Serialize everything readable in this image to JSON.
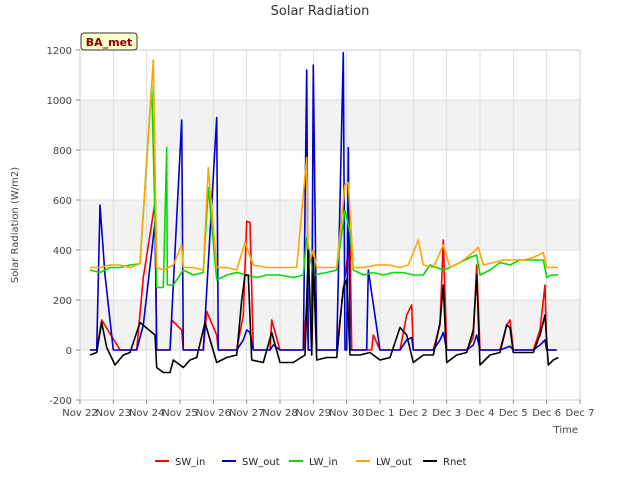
{
  "chart_data": {
    "type": "line",
    "title": "Solar Radiation",
    "xlabel": "Time",
    "ylabel": "Solar Radiation (W/m2)",
    "badge": "BA_met",
    "xlim": [
      0,
      15
    ],
    "ylim": [
      -200,
      1200
    ],
    "x_ticks": [
      {
        "pos": 0,
        "label": "Nov 22"
      },
      {
        "pos": 1,
        "label": "Nov 23"
      },
      {
        "pos": 2,
        "label": "Nov 24"
      },
      {
        "pos": 3,
        "label": "Nov 25"
      },
      {
        "pos": 4,
        "label": "Nov 26"
      },
      {
        "pos": 5,
        "label": "Nov 27"
      },
      {
        "pos": 6,
        "label": "Nov 28"
      },
      {
        "pos": 7,
        "label": "Nov 29"
      },
      {
        "pos": 8,
        "label": "Nov 30"
      },
      {
        "pos": 9,
        "label": "Dec 1"
      },
      {
        "pos": 10,
        "label": "Dec 2"
      },
      {
        "pos": 11,
        "label": "Dec 3"
      },
      {
        "pos": 12,
        "label": "Dec 4"
      },
      {
        "pos": 13,
        "label": "Dec 5"
      },
      {
        "pos": 14,
        "label": "Dec 6"
      },
      {
        "pos": 15,
        "label": "Dec 7"
      }
    ],
    "y_ticks": [
      -200,
      0,
      200,
      400,
      600,
      800,
      1000,
      1200
    ],
    "grid": true,
    "legend_position": "bottom",
    "series": [
      {
        "name": "SW_in",
        "color": "#ff0000",
        "points": [
          [
            0.3,
            0
          ],
          [
            0.5,
            0
          ],
          [
            0.65,
            120
          ],
          [
            1.2,
            0
          ],
          [
            1.7,
            0
          ],
          [
            1.9,
            290
          ],
          [
            2.25,
            590
          ],
          [
            2.3,
            0
          ],
          [
            2.7,
            0
          ],
          [
            2.75,
            120
          ],
          [
            3.05,
            80
          ],
          [
            3.1,
            0
          ],
          [
            3.7,
            0
          ],
          [
            3.8,
            155
          ],
          [
            4.1,
            60
          ],
          [
            4.15,
            0
          ],
          [
            4.7,
            0
          ],
          [
            4.9,
            140
          ],
          [
            5.0,
            515
          ],
          [
            5.1,
            510
          ],
          [
            5.2,
            0
          ],
          [
            5.7,
            0
          ],
          [
            5.75,
            120
          ],
          [
            6.0,
            0
          ],
          [
            6.7,
            0
          ],
          [
            6.8,
            180
          ],
          [
            6.85,
            0
          ],
          [
            6.95,
            0
          ],
          [
            7.0,
            360
          ],
          [
            7.1,
            0
          ],
          [
            7.7,
            0
          ],
          [
            7.9,
            240
          ],
          [
            8.1,
            450
          ],
          [
            8.15,
            0
          ],
          [
            8.75,
            0
          ],
          [
            8.8,
            60
          ],
          [
            9.0,
            0
          ],
          [
            9.6,
            0
          ],
          [
            9.8,
            140
          ],
          [
            9.95,
            180
          ],
          [
            10.0,
            0
          ],
          [
            10.6,
            0
          ],
          [
            10.8,
            100
          ],
          [
            10.9,
            440
          ],
          [
            11.0,
            0
          ],
          [
            11.6,
            0
          ],
          [
            11.8,
            50
          ],
          [
            11.9,
            340
          ],
          [
            12.0,
            0
          ],
          [
            12.6,
            0
          ],
          [
            12.8,
            100
          ],
          [
            12.9,
            120
          ],
          [
            13.0,
            0
          ],
          [
            13.6,
            0
          ],
          [
            13.8,
            80
          ],
          [
            13.95,
            260
          ],
          [
            14.0,
            0
          ],
          [
            14.3,
            0
          ]
        ]
      },
      {
        "name": "SW_out",
        "color": "#0000cc",
        "points": [
          [
            0.3,
            0
          ],
          [
            0.5,
            0
          ],
          [
            0.6,
            580
          ],
          [
            0.75,
            300
          ],
          [
            1.0,
            0
          ],
          [
            1.7,
            0
          ],
          [
            1.9,
            100
          ],
          [
            2.25,
            510
          ],
          [
            2.3,
            0
          ],
          [
            2.7,
            0
          ],
          [
            3.05,
            920
          ],
          [
            3.1,
            0
          ],
          [
            3.7,
            0
          ],
          [
            4.1,
            930
          ],
          [
            4.15,
            0
          ],
          [
            4.7,
            0
          ],
          [
            4.9,
            40
          ],
          [
            5.0,
            80
          ],
          [
            5.1,
            70
          ],
          [
            5.2,
            0
          ],
          [
            5.7,
            0
          ],
          [
            5.8,
            20
          ],
          [
            6.0,
            0
          ],
          [
            6.7,
            0
          ],
          [
            6.8,
            1120
          ],
          [
            6.85,
            0
          ],
          [
            6.95,
            0
          ],
          [
            7.0,
            1140
          ],
          [
            7.1,
            0
          ],
          [
            7.7,
            0
          ],
          [
            7.9,
            1190
          ],
          [
            7.95,
            0
          ],
          [
            8.0,
            0
          ],
          [
            8.05,
            810
          ],
          [
            8.1,
            0
          ],
          [
            8.6,
            0
          ],
          [
            8.65,
            320
          ],
          [
            9.0,
            0
          ],
          [
            9.6,
            0
          ],
          [
            9.8,
            40
          ],
          [
            9.95,
            50
          ],
          [
            10.0,
            0
          ],
          [
            10.6,
            0
          ],
          [
            10.8,
            40
          ],
          [
            10.9,
            70
          ],
          [
            11.0,
            0
          ],
          [
            11.6,
            0
          ],
          [
            11.8,
            20
          ],
          [
            11.9,
            60
          ],
          [
            12.0,
            0
          ],
          [
            12.6,
            0
          ],
          [
            12.8,
            10
          ],
          [
            12.9,
            15
          ],
          [
            13.0,
            0
          ],
          [
            13.6,
            0
          ],
          [
            13.8,
            20
          ],
          [
            13.95,
            40
          ],
          [
            14.0,
            0
          ],
          [
            14.3,
            0
          ]
        ]
      },
      {
        "name": "LW_in",
        "color": "#00dd00",
        "points": [
          [
            0.3,
            320
          ],
          [
            0.6,
            310
          ],
          [
            0.9,
            330
          ],
          [
            1.2,
            330
          ],
          [
            1.5,
            340
          ],
          [
            1.8,
            345
          ],
          [
            2.15,
            1060
          ],
          [
            2.3,
            250
          ],
          [
            2.5,
            250
          ],
          [
            2.6,
            810
          ],
          [
            2.62,
            260
          ],
          [
            2.8,
            260
          ],
          [
            3.1,
            320
          ],
          [
            3.4,
            300
          ],
          [
            3.7,
            310
          ],
          [
            3.85,
            650
          ],
          [
            4.1,
            280
          ],
          [
            4.4,
            300
          ],
          [
            4.7,
            310
          ],
          [
            5.0,
            300
          ],
          [
            5.3,
            290
          ],
          [
            5.6,
            300
          ],
          [
            6.0,
            300
          ],
          [
            6.4,
            290
          ],
          [
            6.7,
            300
          ],
          [
            6.8,
            450
          ],
          [
            7.0,
            300
          ],
          [
            7.4,
            310
          ],
          [
            7.7,
            320
          ],
          [
            7.95,
            560
          ],
          [
            8.1,
            470
          ],
          [
            8.2,
            320
          ],
          [
            8.5,
            300
          ],
          [
            8.8,
            310
          ],
          [
            9.1,
            300
          ],
          [
            9.4,
            310
          ],
          [
            9.7,
            310
          ],
          [
            10.0,
            300
          ],
          [
            10.3,
            300
          ],
          [
            10.5,
            340
          ],
          [
            10.9,
            320
          ],
          [
            11.1,
            330
          ],
          [
            11.4,
            350
          ],
          [
            11.7,
            370
          ],
          [
            11.9,
            380
          ],
          [
            12.0,
            300
          ],
          [
            12.3,
            320
          ],
          [
            12.6,
            350
          ],
          [
            12.9,
            340
          ],
          [
            13.2,
            360
          ],
          [
            13.6,
            360
          ],
          [
            13.9,
            360
          ],
          [
            14.0,
            290
          ],
          [
            14.15,
            300
          ],
          [
            14.35,
            300
          ]
        ]
      },
      {
        "name": "LW_out",
        "color": "#ffa500",
        "points": [
          [
            0.3,
            330
          ],
          [
            0.6,
            330
          ],
          [
            0.9,
            340
          ],
          [
            1.2,
            340
          ],
          [
            1.5,
            330
          ],
          [
            1.8,
            345
          ],
          [
            2.2,
            1160
          ],
          [
            2.3,
            330
          ],
          [
            2.5,
            320
          ],
          [
            2.8,
            340
          ],
          [
            3.05,
            420
          ],
          [
            3.1,
            330
          ],
          [
            3.4,
            330
          ],
          [
            3.7,
            320
          ],
          [
            3.85,
            730
          ],
          [
            4.1,
            330
          ],
          [
            4.4,
            330
          ],
          [
            4.7,
            320
          ],
          [
            4.95,
            430
          ],
          [
            5.2,
            340
          ],
          [
            5.6,
            330
          ],
          [
            6.0,
            330
          ],
          [
            6.5,
            330
          ],
          [
            6.8,
            770
          ],
          [
            6.85,
            340
          ],
          [
            7.0,
            400
          ],
          [
            7.1,
            330
          ],
          [
            7.4,
            330
          ],
          [
            7.7,
            330
          ],
          [
            7.95,
            660
          ],
          [
            8.05,
            670
          ],
          [
            8.2,
            330
          ],
          [
            8.5,
            330
          ],
          [
            8.9,
            340
          ],
          [
            9.3,
            340
          ],
          [
            9.6,
            330
          ],
          [
            9.85,
            340
          ],
          [
            10.15,
            440
          ],
          [
            10.3,
            340
          ],
          [
            10.6,
            330
          ],
          [
            10.9,
            420
          ],
          [
            11.1,
            330
          ],
          [
            11.4,
            350
          ],
          [
            11.7,
            380
          ],
          [
            11.95,
            410
          ],
          [
            12.1,
            340
          ],
          [
            12.4,
            350
          ],
          [
            12.7,
            360
          ],
          [
            13.0,
            360
          ],
          [
            13.3,
            360
          ],
          [
            13.6,
            370
          ],
          [
            13.9,
            390
          ],
          [
            14.0,
            330
          ],
          [
            14.15,
            330
          ],
          [
            14.35,
            330
          ]
        ]
      },
      {
        "name": "Rnet",
        "color": "#000000",
        "points": [
          [
            0.3,
            -20
          ],
          [
            0.5,
            -10
          ],
          [
            0.65,
            110
          ],
          [
            0.8,
            10
          ],
          [
            1.05,
            -60
          ],
          [
            1.3,
            -20
          ],
          [
            1.5,
            -10
          ],
          [
            1.8,
            110
          ],
          [
            2.25,
            60
          ],
          [
            2.3,
            -70
          ],
          [
            2.5,
            -90
          ],
          [
            2.7,
            -90
          ],
          [
            2.8,
            -40
          ],
          [
            3.0,
            -60
          ],
          [
            3.1,
            -70
          ],
          [
            3.3,
            -40
          ],
          [
            3.5,
            -30
          ],
          [
            3.75,
            110
          ],
          [
            4.1,
            -50
          ],
          [
            4.4,
            -30
          ],
          [
            4.7,
            -20
          ],
          [
            4.85,
            200
          ],
          [
            4.95,
            300
          ],
          [
            5.05,
            300
          ],
          [
            5.15,
            -40
          ],
          [
            5.5,
            -50
          ],
          [
            5.75,
            70
          ],
          [
            6.0,
            -50
          ],
          [
            6.4,
            -50
          ],
          [
            6.75,
            -20
          ],
          [
            6.85,
            400
          ],
          [
            6.95,
            -20
          ],
          [
            7.0,
            370
          ],
          [
            7.1,
            -40
          ],
          [
            7.4,
            -30
          ],
          [
            7.7,
            -30
          ],
          [
            7.9,
            250
          ],
          [
            8.0,
            280
          ],
          [
            8.1,
            -20
          ],
          [
            8.4,
            -20
          ],
          [
            8.7,
            -10
          ],
          [
            9.0,
            -40
          ],
          [
            9.3,
            -30
          ],
          [
            9.6,
            90
          ],
          [
            9.8,
            60
          ],
          [
            10.0,
            -50
          ],
          [
            10.3,
            -20
          ],
          [
            10.6,
            -20
          ],
          [
            10.8,
            110
          ],
          [
            10.9,
            260
          ],
          [
            11.0,
            -50
          ],
          [
            11.3,
            -20
          ],
          [
            11.6,
            -10
          ],
          [
            11.8,
            80
          ],
          [
            11.9,
            300
          ],
          [
            12.0,
            -60
          ],
          [
            12.3,
            -20
          ],
          [
            12.6,
            -10
          ],
          [
            12.8,
            100
          ],
          [
            12.9,
            90
          ],
          [
            13.0,
            -10
          ],
          [
            13.3,
            -10
          ],
          [
            13.6,
            -10
          ],
          [
            13.8,
            60
          ],
          [
            13.95,
            140
          ],
          [
            14.05,
            -60
          ],
          [
            14.2,
            -40
          ],
          [
            14.35,
            -30
          ]
        ]
      }
    ]
  }
}
